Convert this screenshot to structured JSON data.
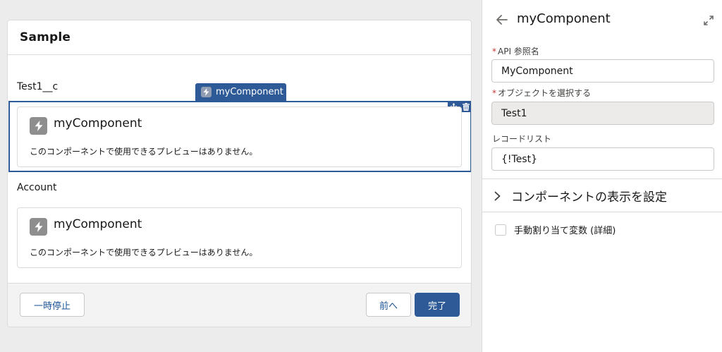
{
  "canvas": {
    "screen_title": "Sample",
    "sections": [
      {
        "label": "Test1__c",
        "component_name": "myComponent",
        "message": "このコンポーネントで使用できるプレビューはありません。"
      },
      {
        "label": "Account",
        "component_name": "myComponent",
        "message": "このコンポーネントで使用できるプレビューはありません。"
      }
    ],
    "selected_tab_label": "myComponent",
    "footer": {
      "pause_label": "一時停止",
      "previous_label": "前へ",
      "finish_label": "完了"
    }
  },
  "panel": {
    "title": "myComponent",
    "fields": [
      {
        "label": "API 参照名",
        "required": "*",
        "value": "MyComponent"
      },
      {
        "label": "オブジェクトを選択する",
        "required": "*",
        "value": "Test1"
      },
      {
        "label": "レコードリスト",
        "value": "{!Test}"
      }
    ],
    "visibility_label": "コンポーネントの表示を設定",
    "manual_assign_label": "手動割り当て変数 (詳細)"
  },
  "colors": {
    "brand": "#2e5a97",
    "required": "#c23934",
    "icon_gray": "#8e8e8e"
  },
  "icons": [
    "lightning-icon",
    "move-icon",
    "trash-icon",
    "back-arrow-icon",
    "expand-icon",
    "chevron-right-icon"
  ]
}
